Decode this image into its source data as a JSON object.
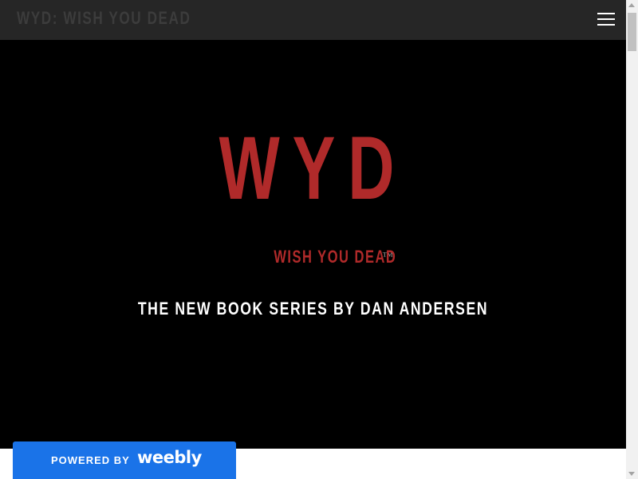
{
  "header": {
    "site_title": "WYD: WISH YOU DEAD",
    "menu_icon": "hamburger-menu-icon",
    "background_color": "#262626"
  },
  "hero": {
    "title": "WYD",
    "tagline": "WISH YOU DEAD",
    "trademark": "™",
    "subtitle": "THE NEW BOOK SERIES BY DAN ANDERSEN",
    "background_color": "#000000",
    "accent_color": "#b02a2a"
  },
  "badge": {
    "powered_by": "POWERED BY",
    "brand": "weebly",
    "background_color": "#1a73e8"
  }
}
